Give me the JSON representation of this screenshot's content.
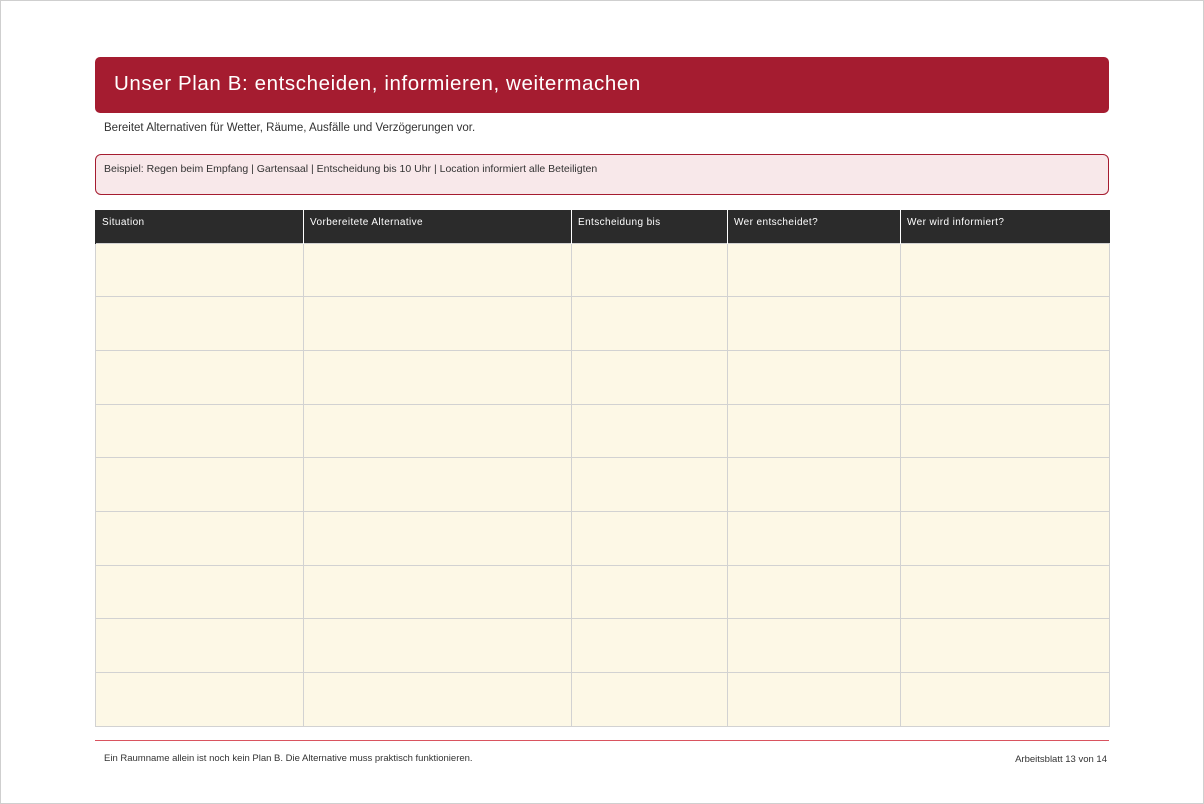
{
  "header": {
    "title": "Unser Plan B: entscheiden, informieren, weitermachen"
  },
  "subtitle": "Bereitet Alternativen für Wetter, Räume, Ausfälle und Verzögerungen vor.",
  "example": "Beispiel: Regen beim Empfang | Gartensaal | Entscheidung bis 10 Uhr | Location informiert alle Beteiligten",
  "table": {
    "columns": [
      "Situation",
      "Vorbereitete Alternative",
      "Entscheidung bis",
      "Wer entscheidet?",
      "Wer wird informiert?"
    ],
    "row_count": 9
  },
  "footer": {
    "note": "Ein Raumname allein ist noch kein Plan B. Die Alternative muss praktisch funktionieren.",
    "page": "Arbeitsblatt 13 von 14"
  },
  "colors": {
    "accent": "#a51c30",
    "example_bg": "#f8e8ea",
    "header_row": "#2b2b2b",
    "cell_bg": "#fdf8e6"
  }
}
